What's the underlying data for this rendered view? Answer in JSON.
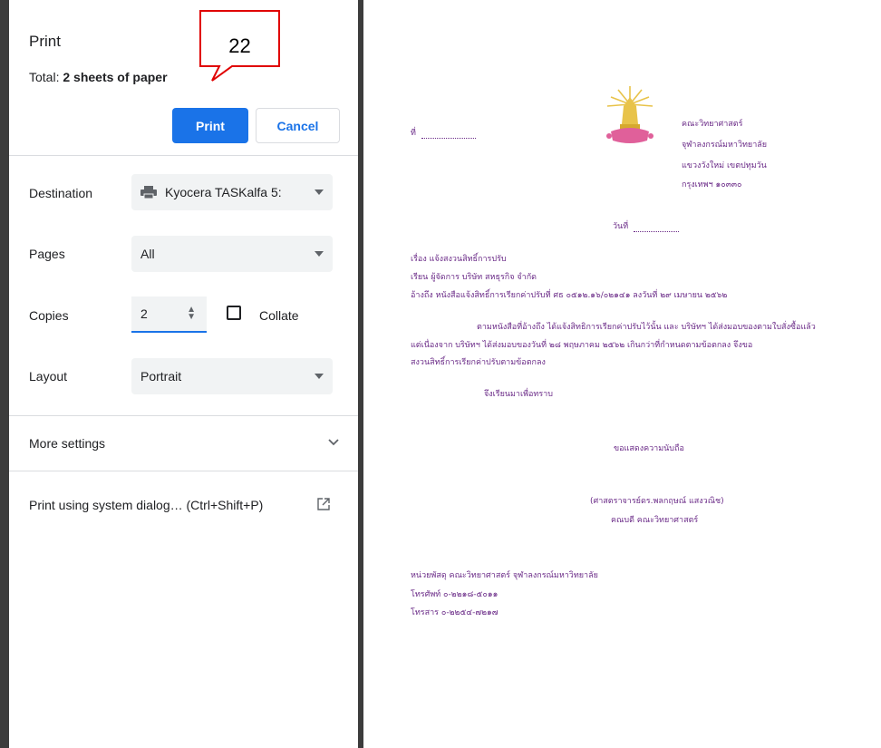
{
  "print_panel": {
    "title": "Print",
    "total_prefix": "Total:",
    "total_value": "2 sheets of paper",
    "print_button": "Print",
    "cancel_button": "Cancel",
    "destination_label": "Destination",
    "destination_value": "Kyocera TASKalfa 5:",
    "pages_label": "Pages",
    "pages_value": "All",
    "copies_label": "Copies",
    "copies_value": "2",
    "collate_label": "Collate",
    "layout_label": "Layout",
    "layout_value": "Portrait",
    "more_settings": "More settings",
    "system_dialog": "Print using system dialog… (Ctrl+Shift+P)"
  },
  "callout": {
    "number": "22",
    "color": "#e00000"
  },
  "preview": {
    "ref_no_label": "ที่",
    "sender_lines": [
      "คณะวิทยาศาสตร์",
      "จุฬาลงกรณ์มหาวิทยาลัย",
      "แขวงวังใหม่ เขตปทุมวัน",
      "กรุงเทพฯ ๑๐๓๓๐"
    ],
    "date_label": "วันที่",
    "subject": "เรื่อง    แจ้งสงวนสิทธิ์การปรับ",
    "to": "เรียน    ผู้จัดการ บริษัท สหธุรกิจ จำกัด",
    "reference": "อ้างถึง   หนังสือแจ้งสิทธิ์การเรียกค่าปรับที่ ศธ ๐๕๑๒.๑๖/๐๒๑๔๑ ลงวันที่ ๒๙ เมษายน ๒๕๖๒",
    "body_line1": "ตามหนังสือที่อ้างถึง ได้แจ้งสิทธิการเรียกค่าปรับไว้นั้น และ บริษัทฯ ได้ส่งมอบของตามใบสั่งซื้อแล้ว",
    "body_line2": "แต่เนื่องจาก บริษัทฯ ได้ส่งมอบของวันที่ ๒๘ พฤษภาคม ๒๕๖๒ เกินกว่าที่กำหนดตามข้อตกลง จึงขอ",
    "body_line3": "สงวนสิทธิ์การเรียกค่าปรับตามข้อตกลง",
    "closing_inform": "จึงเรียนมาเพื่อทราบ",
    "closing_regards": "ขอแสดงความนับถือ",
    "signer_name": "(ศาสตราจารย์ดร.พลกฤษณ์ แสงวณิช)",
    "signer_title": "คณบดี คณะวิทยาศาสตร์",
    "unit": "หน่วยพัสดุ คณะวิทยาศาสตร์ จุฬาลงกรณ์มหาวิทยาลัย",
    "phone": "โทรศัพท์   ๐-๒๒๑๘-๕๐๑๑",
    "fax": "โทรสาร    ๐-๒๒๕๔-๗๒๑๗"
  },
  "colors": {
    "accent": "#1a73e8",
    "letter_text": "#6a2a87",
    "emblem_gold": "#e8c34a",
    "emblem_pink": "#e0609a"
  }
}
